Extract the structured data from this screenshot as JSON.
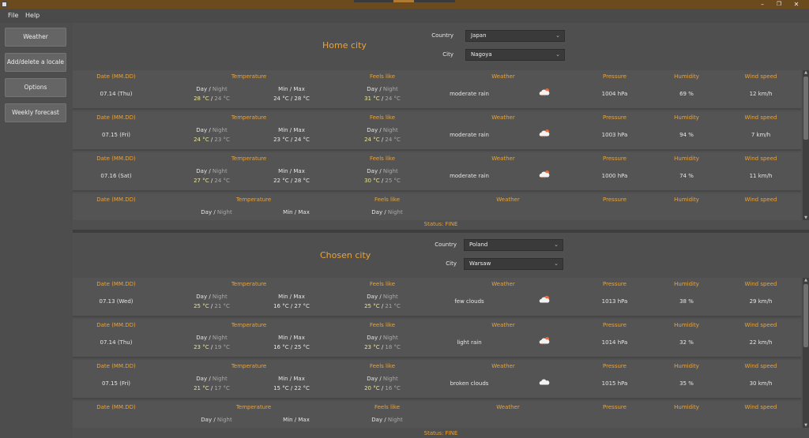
{
  "window": {
    "minimize": "–",
    "maximize": "❐",
    "close": "✕"
  },
  "menu": [
    {
      "label": "File"
    },
    {
      "label": "Help"
    }
  ],
  "sidebar": [
    {
      "label": "Weather"
    },
    {
      "label": "Add/delete a locale"
    },
    {
      "label": "Options"
    },
    {
      "label": "Weekly forecast"
    }
  ],
  "columns": {
    "date": "Date (MM.DD)",
    "temperature": "Temperature",
    "feels_like": "Feels like",
    "weather": "Weather",
    "pressure": "Pressure",
    "humidity": "Humidity",
    "wind": "Wind speed",
    "day": "Day",
    "slash": " / ",
    "night": "Night",
    "minmax": "Min / Max"
  },
  "home": {
    "title": "Home city",
    "country_label": "Country",
    "country": "Japan",
    "city_label": "City",
    "city": "Nagoya",
    "status": "Status: FINE",
    "rows": [
      {
        "date": "07.14 (Thu)",
        "temp_day": "28 °C",
        "temp_night": "24 °C",
        "minmax": "24 °C / 28 °C",
        "feels_day": "31 °C",
        "feels_night": "24 °C",
        "weather": "moderate rain",
        "icon": "rain-icon",
        "pressure": "1004 hPa",
        "humidity": "69 %",
        "wind": "12 km/h"
      },
      {
        "date": "07.15 (Fri)",
        "temp_day": "24 °C",
        "temp_night": "23 °C",
        "minmax": "23 °C / 24 °C",
        "feels_day": "24 °C",
        "feels_night": "24 °C",
        "weather": "moderate rain",
        "icon": "rain-icon",
        "pressure": "1003 hPa",
        "humidity": "94 %",
        "wind": "7 km/h"
      },
      {
        "date": "07.16 (Sat)",
        "temp_day": "27 °C",
        "temp_night": "24 °C",
        "minmax": "22 °C / 28 °C",
        "feels_day": "30 °C",
        "feels_night": "25 °C",
        "weather": "moderate rain",
        "icon": "rain-icon",
        "pressure": "1000 hPa",
        "humidity": "74 %",
        "wind": "11 km/h"
      }
    ]
  },
  "chosen": {
    "title": "Chosen city",
    "country_label": "Country",
    "country": "Poland",
    "city_label": "City",
    "city": "Warsaw",
    "status": "Status: FINE",
    "rows": [
      {
        "date": "07.13 (Wed)",
        "temp_day": "25 °C",
        "temp_night": "21 °C",
        "minmax": "16 °C / 27 °C",
        "feels_day": "25 °C",
        "feels_night": "21 °C",
        "weather": "few clouds",
        "icon": "few-clouds-icon",
        "pressure": "1013 hPa",
        "humidity": "38 %",
        "wind": "29 km/h"
      },
      {
        "date": "07.14 (Thu)",
        "temp_day": "23 °C",
        "temp_night": "19 °C",
        "minmax": "16 °C / 25 °C",
        "feels_day": "23 °C",
        "feels_night": "18 °C",
        "weather": "light rain",
        "icon": "rain-icon",
        "pressure": "1014 hPa",
        "humidity": "32 %",
        "wind": "22 km/h"
      },
      {
        "date": "07.15 (Fri)",
        "temp_day": "21 °C",
        "temp_night": "17 °C",
        "minmax": "15 °C / 22 °C",
        "feels_day": "20 °C",
        "feels_night": "16 °C",
        "weather": "broken clouds",
        "icon": "broken-clouds-icon",
        "pressure": "1015 hPa",
        "humidity": "35 %",
        "wind": "30 km/h"
      }
    ]
  }
}
